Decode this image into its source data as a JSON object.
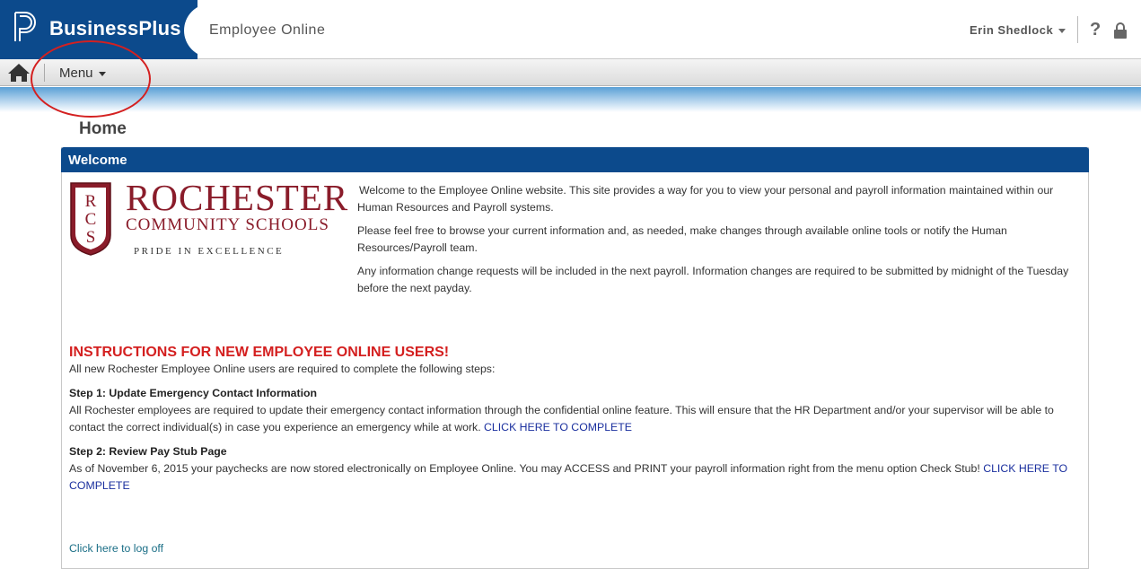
{
  "header": {
    "brand_name": "BusinessPlus",
    "app_title": "Employee Online",
    "user_name": "Erin Shedlock",
    "help_label": "?",
    "brand_color": "#0c4a8c"
  },
  "menubar": {
    "menu_label": "Menu",
    "home_icon": "home-icon"
  },
  "page": {
    "title": "Home"
  },
  "welcome_panel": {
    "title": "Welcome",
    "logo": {
      "line1": "ROCHESTER",
      "line2": "COMMUNITY SCHOOLS",
      "tagline": "PRIDE IN EXCELLENCE",
      "crest_letters": [
        "R",
        "C",
        "S"
      ]
    },
    "paragraphs": [
      "Welcome to the Employee Online website. This site provides a way for you to view your personal and payroll information maintained within our Human Resources and Payroll systems.",
      "Please feel free to browse your current information and, as needed, make changes through available online tools or notify the Human Resources/Payroll team.",
      "Any information change requests will be included in the next payroll. Information changes are required to be submitted by midnight of the Tuesday before the next payday."
    ]
  },
  "instructions": {
    "heading": "INSTRUCTIONS FOR NEW EMPLOYEE ONLINE USERS!",
    "intro": "All new Rochester Employee Online users are required to complete the following steps:",
    "steps": [
      {
        "title": "Step 1: Update Emergency Contact Information",
        "body": "All Rochester employees are required to update their emergency contact information through the confidential online feature. This will ensure that the HR Department and/or your supervisor will be able to contact the correct individual(s) in case you experience an emergency while at work.",
        "link": "CLICK HERE TO COMPLETE"
      },
      {
        "title": "Step 2: Review Pay Stub Page",
        "body": "As of November 6, 2015 your paychecks are now stored electronically on Employee Online. You may ACCESS and PRINT your payroll information right from the menu option Check Stub!",
        "link": "CLICK HERE TO COMPLETE"
      }
    ],
    "logoff_link": "Click here to log off"
  }
}
